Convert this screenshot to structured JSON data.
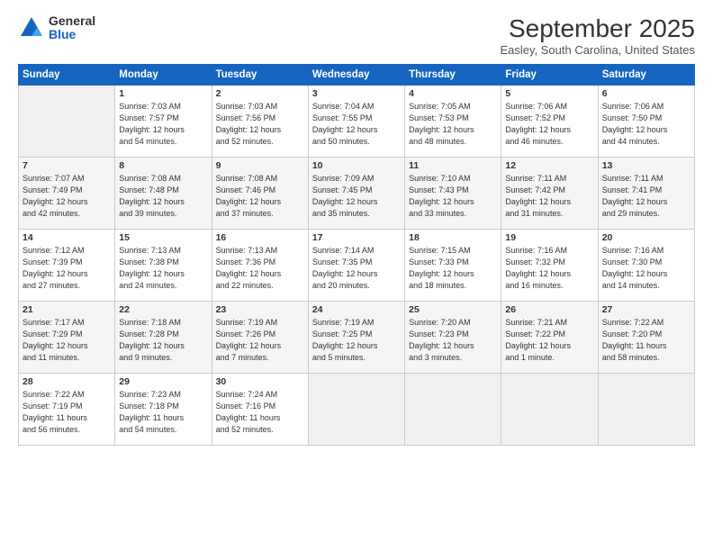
{
  "logo": {
    "general": "General",
    "blue": "Blue"
  },
  "title": "September 2025",
  "location": "Easley, South Carolina, United States",
  "days_of_week": [
    "Sunday",
    "Monday",
    "Tuesday",
    "Wednesday",
    "Thursday",
    "Friday",
    "Saturday"
  ],
  "weeks": [
    [
      {
        "day": "",
        "info": ""
      },
      {
        "day": "1",
        "info": "Sunrise: 7:03 AM\nSunset: 7:57 PM\nDaylight: 12 hours\nand 54 minutes."
      },
      {
        "day": "2",
        "info": "Sunrise: 7:03 AM\nSunset: 7:56 PM\nDaylight: 12 hours\nand 52 minutes."
      },
      {
        "day": "3",
        "info": "Sunrise: 7:04 AM\nSunset: 7:55 PM\nDaylight: 12 hours\nand 50 minutes."
      },
      {
        "day": "4",
        "info": "Sunrise: 7:05 AM\nSunset: 7:53 PM\nDaylight: 12 hours\nand 48 minutes."
      },
      {
        "day": "5",
        "info": "Sunrise: 7:06 AM\nSunset: 7:52 PM\nDaylight: 12 hours\nand 46 minutes."
      },
      {
        "day": "6",
        "info": "Sunrise: 7:06 AM\nSunset: 7:50 PM\nDaylight: 12 hours\nand 44 minutes."
      }
    ],
    [
      {
        "day": "7",
        "info": "Sunrise: 7:07 AM\nSunset: 7:49 PM\nDaylight: 12 hours\nand 42 minutes."
      },
      {
        "day": "8",
        "info": "Sunrise: 7:08 AM\nSunset: 7:48 PM\nDaylight: 12 hours\nand 39 minutes."
      },
      {
        "day": "9",
        "info": "Sunrise: 7:08 AM\nSunset: 7:46 PM\nDaylight: 12 hours\nand 37 minutes."
      },
      {
        "day": "10",
        "info": "Sunrise: 7:09 AM\nSunset: 7:45 PM\nDaylight: 12 hours\nand 35 minutes."
      },
      {
        "day": "11",
        "info": "Sunrise: 7:10 AM\nSunset: 7:43 PM\nDaylight: 12 hours\nand 33 minutes."
      },
      {
        "day": "12",
        "info": "Sunrise: 7:11 AM\nSunset: 7:42 PM\nDaylight: 12 hours\nand 31 minutes."
      },
      {
        "day": "13",
        "info": "Sunrise: 7:11 AM\nSunset: 7:41 PM\nDaylight: 12 hours\nand 29 minutes."
      }
    ],
    [
      {
        "day": "14",
        "info": "Sunrise: 7:12 AM\nSunset: 7:39 PM\nDaylight: 12 hours\nand 27 minutes."
      },
      {
        "day": "15",
        "info": "Sunrise: 7:13 AM\nSunset: 7:38 PM\nDaylight: 12 hours\nand 24 minutes."
      },
      {
        "day": "16",
        "info": "Sunrise: 7:13 AM\nSunset: 7:36 PM\nDaylight: 12 hours\nand 22 minutes."
      },
      {
        "day": "17",
        "info": "Sunrise: 7:14 AM\nSunset: 7:35 PM\nDaylight: 12 hours\nand 20 minutes."
      },
      {
        "day": "18",
        "info": "Sunrise: 7:15 AM\nSunset: 7:33 PM\nDaylight: 12 hours\nand 18 minutes."
      },
      {
        "day": "19",
        "info": "Sunrise: 7:16 AM\nSunset: 7:32 PM\nDaylight: 12 hours\nand 16 minutes."
      },
      {
        "day": "20",
        "info": "Sunrise: 7:16 AM\nSunset: 7:30 PM\nDaylight: 12 hours\nand 14 minutes."
      }
    ],
    [
      {
        "day": "21",
        "info": "Sunrise: 7:17 AM\nSunset: 7:29 PM\nDaylight: 12 hours\nand 11 minutes."
      },
      {
        "day": "22",
        "info": "Sunrise: 7:18 AM\nSunset: 7:28 PM\nDaylight: 12 hours\nand 9 minutes."
      },
      {
        "day": "23",
        "info": "Sunrise: 7:19 AM\nSunset: 7:26 PM\nDaylight: 12 hours\nand 7 minutes."
      },
      {
        "day": "24",
        "info": "Sunrise: 7:19 AM\nSunset: 7:25 PM\nDaylight: 12 hours\nand 5 minutes."
      },
      {
        "day": "25",
        "info": "Sunrise: 7:20 AM\nSunset: 7:23 PM\nDaylight: 12 hours\nand 3 minutes."
      },
      {
        "day": "26",
        "info": "Sunrise: 7:21 AM\nSunset: 7:22 PM\nDaylight: 12 hours\nand 1 minute."
      },
      {
        "day": "27",
        "info": "Sunrise: 7:22 AM\nSunset: 7:20 PM\nDaylight: 11 hours\nand 58 minutes."
      }
    ],
    [
      {
        "day": "28",
        "info": "Sunrise: 7:22 AM\nSunset: 7:19 PM\nDaylight: 11 hours\nand 56 minutes."
      },
      {
        "day": "29",
        "info": "Sunrise: 7:23 AM\nSunset: 7:18 PM\nDaylight: 11 hours\nand 54 minutes."
      },
      {
        "day": "30",
        "info": "Sunrise: 7:24 AM\nSunset: 7:16 PM\nDaylight: 11 hours\nand 52 minutes."
      },
      {
        "day": "",
        "info": ""
      },
      {
        "day": "",
        "info": ""
      },
      {
        "day": "",
        "info": ""
      },
      {
        "day": "",
        "info": ""
      }
    ]
  ]
}
